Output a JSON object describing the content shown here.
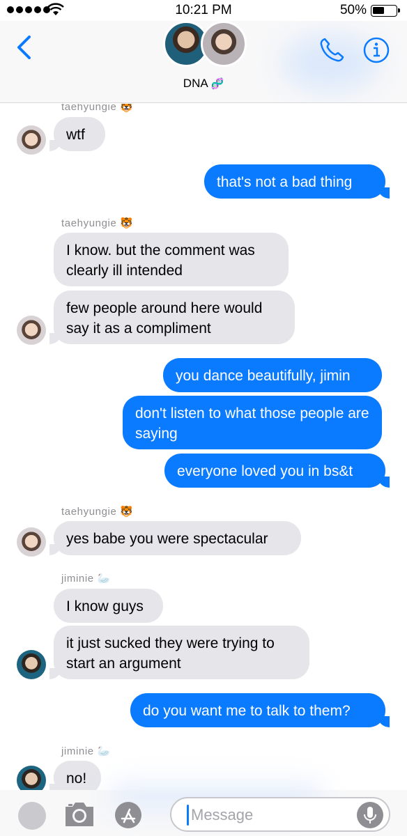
{
  "status_bar": {
    "time": "10:21 PM",
    "battery": "50%"
  },
  "header": {
    "group_name": "DNA",
    "group_emoji": "🧬"
  },
  "messages": {
    "m1_sender": "taehyungie 🐯",
    "m1": "wtf",
    "m2": "that's not a bad thing",
    "m3_sender": "taehyungie 🐯",
    "m3": "I know. but the comment was clearly ill intended",
    "m4": "few people around here would say it as a compliment",
    "m5": "you dance beautifully, jimin",
    "m6": "don't listen to what those people are saying",
    "m7": "everyone loved you in bs&t",
    "m8_sender": "taehyungie 🐯",
    "m8": "yes babe you were spectacular",
    "m9_sender": "jiminie 🦢",
    "m9": "I know guys",
    "m10": "it just sucked they were trying to start an argument",
    "m11": "do you want me to talk to them?",
    "m12_sender": "jiminie 🦢",
    "m12": "no!"
  },
  "composer": {
    "placeholder": "Message"
  },
  "colors": {
    "sent": "#0a7aff",
    "received": "#e5e5ea",
    "accent": "#0a7aff"
  }
}
